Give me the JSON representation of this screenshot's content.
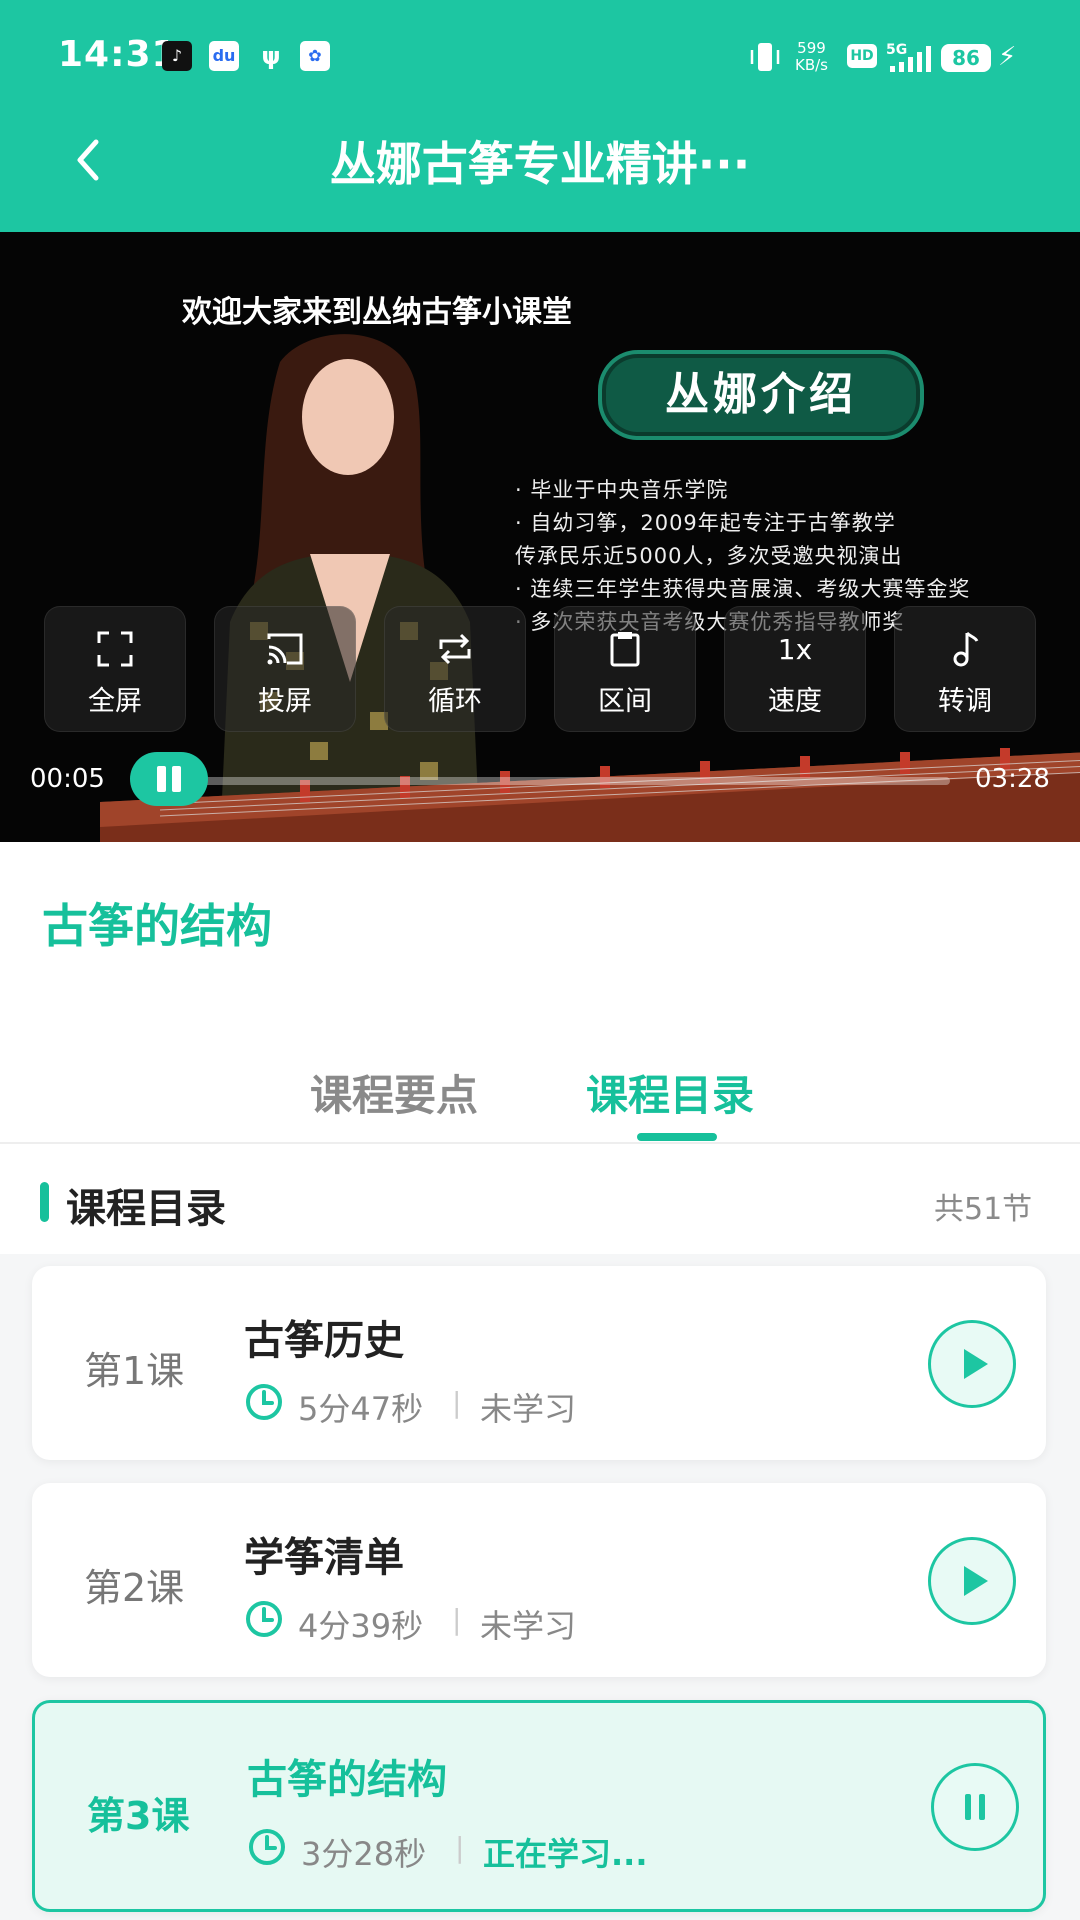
{
  "status_bar": {
    "time": "14:31",
    "net_speed_value": "599",
    "net_speed_unit": "KB/s",
    "hd": "HD",
    "network": "5G",
    "battery": "86",
    "app_icons": [
      "tiktok-icon",
      "du-icon",
      "usb-icon",
      "baidu-icon"
    ]
  },
  "header": {
    "title": "丛娜古筝专业精讲···"
  },
  "video": {
    "heading": "欢迎大家来到丛纳古筝小课堂",
    "badge": "丛娜介绍",
    "bio_lines": [
      "· 毕业于中央音乐学院",
      "· 自幼习筝，2009年起专注于古筝教学",
      "  传承民乐近5000人，多次受邀央视演出",
      "· 连续三年学生获得央音展演、考级大赛等金奖",
      "· 多次荣获央音考级大赛优秀指导教师奖"
    ],
    "controls": {
      "fullscreen": "全屏",
      "cast": "投屏",
      "loop": "循环",
      "range": "区间",
      "speed_value": "1x",
      "speed": "速度",
      "transpose": "转调"
    },
    "current_time": "00:05",
    "total_time": "03:28",
    "progress": 0.024
  },
  "lesson_title": "古筝的结构",
  "tabs": {
    "points": "课程要点",
    "catalog": "课程目录",
    "active": "catalog"
  },
  "catalog": {
    "heading": "课程目录",
    "count": "共51节",
    "lessons": [
      {
        "num": "第1课",
        "name": "古筝历史",
        "duration": "5分47秒",
        "sep": "|",
        "state": "未学习",
        "active": false
      },
      {
        "num": "第2课",
        "name": "学筝清单",
        "duration": "4分39秒",
        "sep": "|",
        "state": "未学习",
        "active": false
      },
      {
        "num": "第3课",
        "name": "古筝的结构",
        "duration": "3分28秒",
        "sep": "|",
        "state": "正在学习...",
        "active": true
      }
    ]
  },
  "colors": {
    "accent": "#1dc6a2",
    "accent_text": "#16c09b"
  }
}
